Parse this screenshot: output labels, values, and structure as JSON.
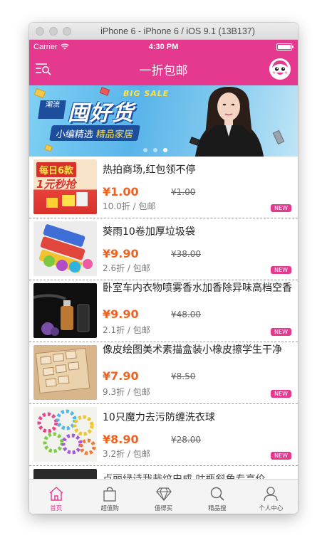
{
  "window": {
    "title": "iPhone 6 - iPhone 6 / iOS 9.1 (13B137)"
  },
  "status_bar": {
    "carrier": "Carrier",
    "time": "4:30 PM"
  },
  "nav": {
    "title": "一折包邮",
    "menu_icon": "filter-list-icon",
    "avatar_icon": "cartoon-face-icon"
  },
  "banner": {
    "sale_text": "BIG SALE",
    "badge": "潮流",
    "headline": "囤好货",
    "subtitle_part1": "小编精选",
    "subtitle_part2": "精品家居",
    "dots_total": 3,
    "active_dot": 2
  },
  "thumb_badge": {
    "line1": "每日6款",
    "line2": "1元秒抢"
  },
  "products": [
    {
      "name": "热拍商场,红包领不停",
      "price": "¥1.00",
      "original": "¥1.00",
      "meta": "10.0折 / 包邮",
      "badge": "NEW"
    },
    {
      "name": "葵雨10卷加厚垃圾袋",
      "price": "¥9.90",
      "original": "¥38.00",
      "meta": "2.6折 / 包邮",
      "badge": "NEW"
    },
    {
      "name": "卧室车内衣物喷雾香水加香除异味高档空香",
      "price": "¥9.90",
      "original": "¥48.00",
      "meta": "2.1折 / 包邮",
      "badge": "NEW"
    },
    {
      "name": "像皮绘图美术素描盒装小橡皮擦学生干净",
      "price": "¥7.90",
      "original": "¥8.50",
      "meta": "9.3折 / 包邮",
      "badge": "NEW"
    },
    {
      "name": "10只魔力去污防缠洗衣球",
      "price": "¥8.90",
      "original": "¥28.00",
      "meta": "3.2折 / 包邮",
      "badge": "NEW"
    },
    {
      "name": "卢丽绿诗我裁纹史成 咕瓶斜角专高价",
      "price": "",
      "original": "",
      "meta": "",
      "badge": ""
    }
  ],
  "tabs": [
    {
      "label": "首页",
      "icon": "home-icon",
      "active": true
    },
    {
      "label": "超值购",
      "icon": "shopping-bag-icon",
      "active": false
    },
    {
      "label": "值得买",
      "icon": "diamond-icon",
      "active": false
    },
    {
      "label": "精品搜",
      "icon": "search-icon",
      "active": false
    },
    {
      "label": "个人中心",
      "icon": "person-icon",
      "active": false
    }
  ],
  "colors": {
    "brand_pink": "#e4398f",
    "price_orange": "#ee6321",
    "tab_background": "#f4f4f4"
  }
}
